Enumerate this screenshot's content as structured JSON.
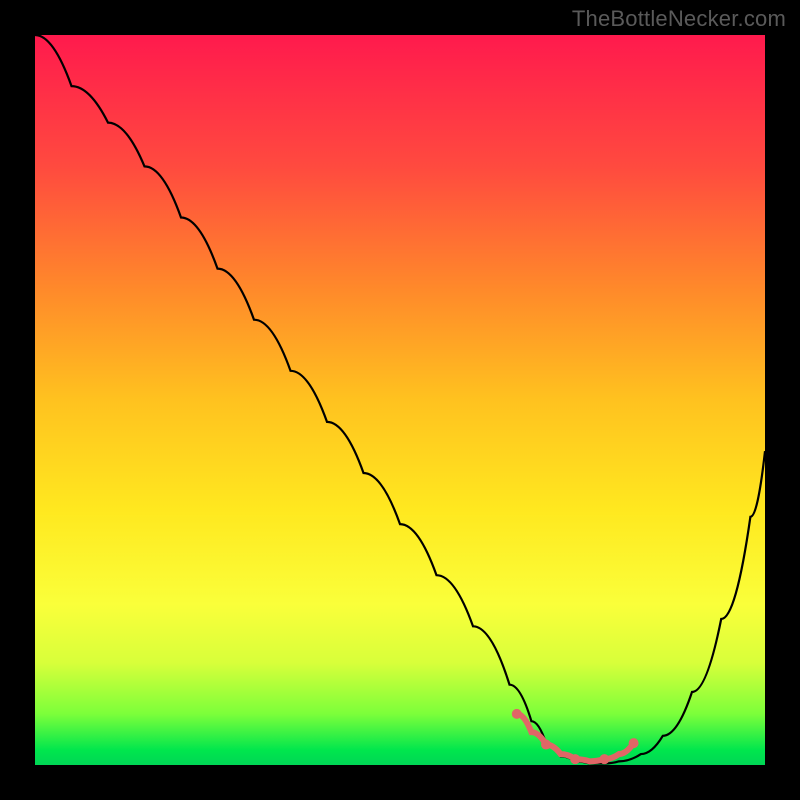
{
  "attribution": "TheBottleNecker.com",
  "colors": {
    "page_bg": "#000000",
    "gradient_top": "#ff1a4d",
    "gradient_bottom": "#00d655",
    "curve": "#000000",
    "fit_marker": "#e06666"
  },
  "chart_data": {
    "type": "line",
    "title": "",
    "xlabel": "",
    "ylabel": "",
    "xlim": [
      0,
      100
    ],
    "ylim": [
      0,
      100
    ],
    "series": [
      {
        "name": "bottleneck-curve",
        "x": [
          0,
          5,
          10,
          15,
          20,
          25,
          30,
          35,
          40,
          45,
          50,
          55,
          60,
          65,
          68,
          70,
          72,
          74,
          76,
          78,
          80,
          83,
          86,
          90,
          94,
          98,
          100
        ],
        "y": [
          100,
          93,
          88,
          82,
          75,
          68,
          61,
          54,
          47,
          40,
          33,
          26,
          19,
          11,
          6,
          3,
          1.2,
          0.5,
          0.2,
          0.2,
          0.5,
          1.5,
          4,
          10,
          20,
          34,
          43
        ]
      }
    ],
    "good_fit_region": {
      "x_start": 66,
      "x_end": 82,
      "points_x": [
        66,
        68,
        70,
        72,
        74,
        76,
        78,
        80,
        82
      ],
      "points_y": [
        7,
        4.5,
        2.8,
        1.5,
        0.8,
        0.5,
        0.8,
        1.5,
        3
      ]
    }
  }
}
